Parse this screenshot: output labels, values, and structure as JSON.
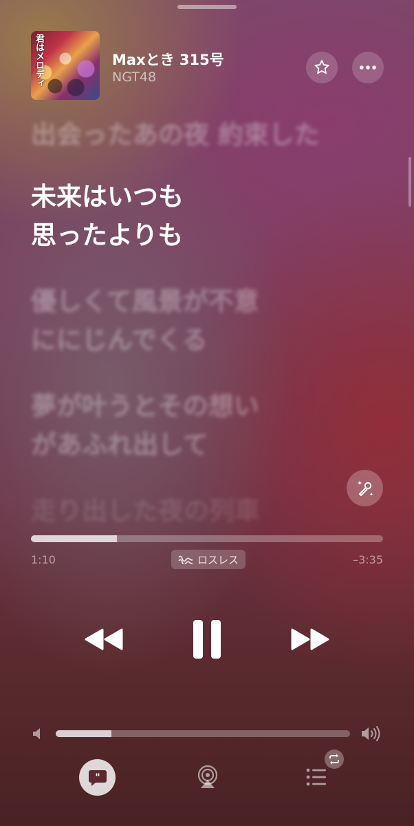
{
  "track": {
    "title": "Maxとき 315号",
    "artist": "NGT48",
    "artwork_text": "君はメロディ"
  },
  "lyrics": [
    {
      "text": "出会ったあの夜 約束した",
      "state": "past"
    },
    {
      "text": "未来はいつも\n思ったよりも",
      "state": "current"
    },
    {
      "text": "優しくて風景が不意\nににじんでくる",
      "state": "upcoming"
    },
    {
      "text": "夢が叶うとその想い\nがあふれ出して",
      "state": "upcoming"
    },
    {
      "text": "走り出した夜の列車",
      "state": "upcoming"
    }
  ],
  "playback": {
    "elapsed": "1:10",
    "remaining": "–3:35",
    "progress_fraction": 0.245,
    "quality_badge": "ロスレス",
    "volume_fraction": 0.19
  },
  "icons": {
    "favorite": "star-icon",
    "more": "ellipsis-icon",
    "sing": "microphone-sparkles-icon",
    "rewind": "backward-icon",
    "pause": "pause-icon",
    "forward": "forward-icon",
    "lyrics": "quote-bubble-icon",
    "airplay": "airplay-icon",
    "queue": "list-icon",
    "repeat": "repeat-icon"
  }
}
